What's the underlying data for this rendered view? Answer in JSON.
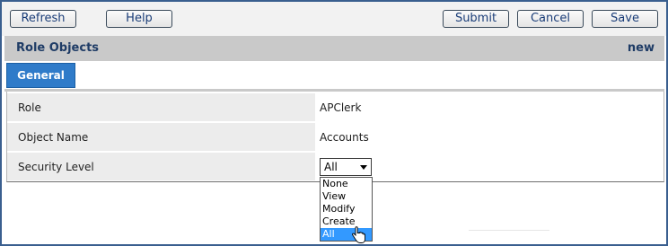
{
  "toolbar": {
    "refresh_label": "Refresh",
    "help_label": "Help",
    "submit_label": "Submit",
    "cancel_label": "Cancel",
    "save_label": "Save"
  },
  "header": {
    "title": "Role Objects",
    "status": "new"
  },
  "tabs": [
    {
      "label": "General",
      "active": true
    }
  ],
  "form": {
    "rows": [
      {
        "label": "Role",
        "value": "APClerk"
      },
      {
        "label": "Object Name",
        "value": "Accounts"
      },
      {
        "label": "Security Level",
        "value": "All"
      }
    ]
  },
  "security_level_options": [
    "None",
    "View",
    "Modify",
    "Create",
    "All"
  ],
  "security_level_selected": "All",
  "colors": {
    "frame_border": "#3a5f8f",
    "tab_active": "#2f7bc9",
    "header_bg": "#c9c9c9",
    "header_text": "#1f3c66",
    "option_highlight": "#3399ff"
  },
  "icons": {
    "cursor": "hand-pointer-icon",
    "dropdown_caret": "caret-down-icon"
  }
}
